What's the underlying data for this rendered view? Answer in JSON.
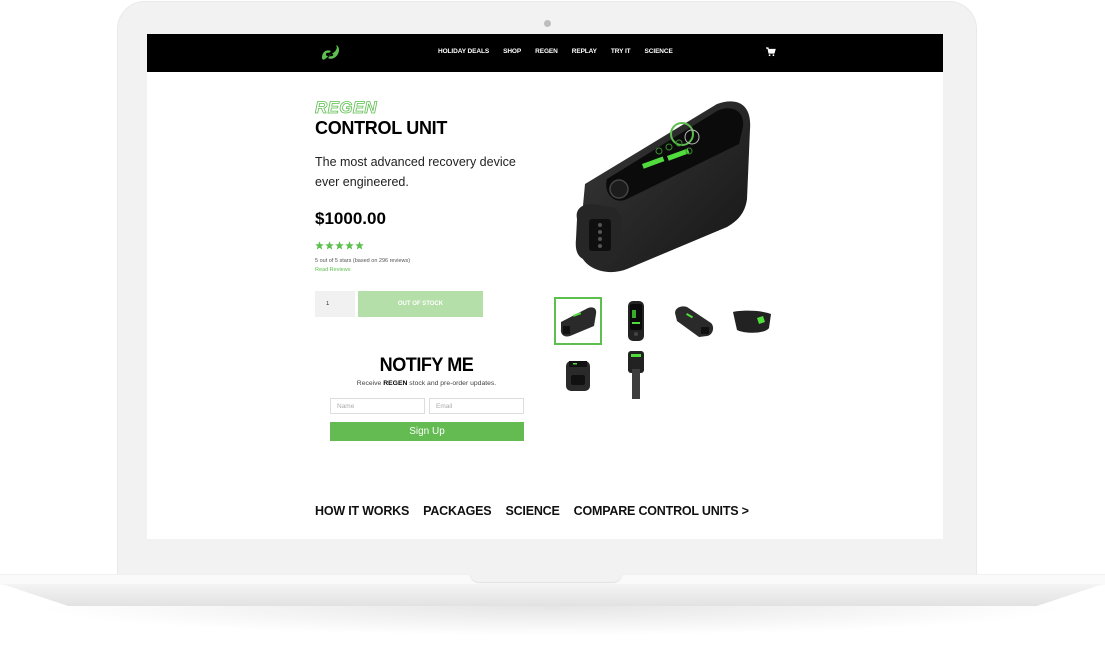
{
  "nav": {
    "links": [
      "HOLIDAY DEALS",
      "SHOP",
      "REGEN",
      "REPLAY",
      "TRY IT",
      "SCIENCE"
    ],
    "logo_icon": "brand-swirl-icon",
    "cart_icon": "cart-icon"
  },
  "product": {
    "brand": "REGEN",
    "title": "CONTROL UNIT",
    "tagline": "The most advanced recovery device ever engineered.",
    "price": "$1000.00",
    "rating": 5,
    "rating_max": 5,
    "rating_text": "5 out of 5 stars (based on 296 reviews)",
    "read_reviews": "Read Reviews",
    "quantity": "1",
    "stock_button": "OUT OF STOCK",
    "thumbnails": [
      "front-angle",
      "top-view",
      "side-angle",
      "rear-angle",
      "front-view",
      "strap-view"
    ],
    "active_thumbnail": 0
  },
  "notify": {
    "title": "NOTIFY ME",
    "subtitle_prefix": "Receive ",
    "subtitle_brand": "REGEN",
    "subtitle_suffix": " stock and pre-order updates.",
    "name_placeholder": "Name",
    "email_placeholder": "Email",
    "signup_label": "Sign Up"
  },
  "bottom_nav": [
    "HOW IT WORKS",
    "PACKAGES",
    "SCIENCE",
    "COMPARE CONTROL UNITS >"
  ],
  "colors": {
    "accent": "#5cbf4e",
    "nav_bg": "#000000",
    "oos_button": "#b4dfa8",
    "signup_button": "#63bb52"
  }
}
